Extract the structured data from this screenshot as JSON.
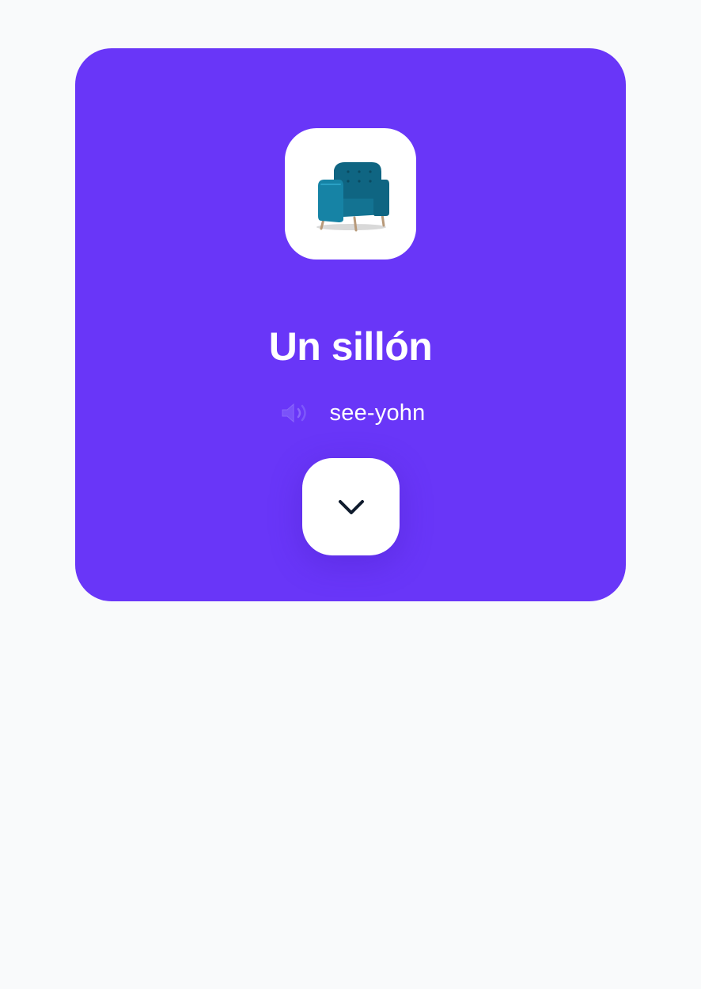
{
  "card": {
    "background_color": "#6936f8",
    "image_icon": "armchair-image",
    "word": "Un sillón",
    "pronunciation": "see-yohn",
    "speaker_icon": "speaker-icon",
    "expand_icon": "chevron-down-icon"
  },
  "colors": {
    "page_background": "#f9fafb",
    "card": "#6936f8",
    "armchair": "#137392",
    "chevron": "#0f1b2d"
  }
}
